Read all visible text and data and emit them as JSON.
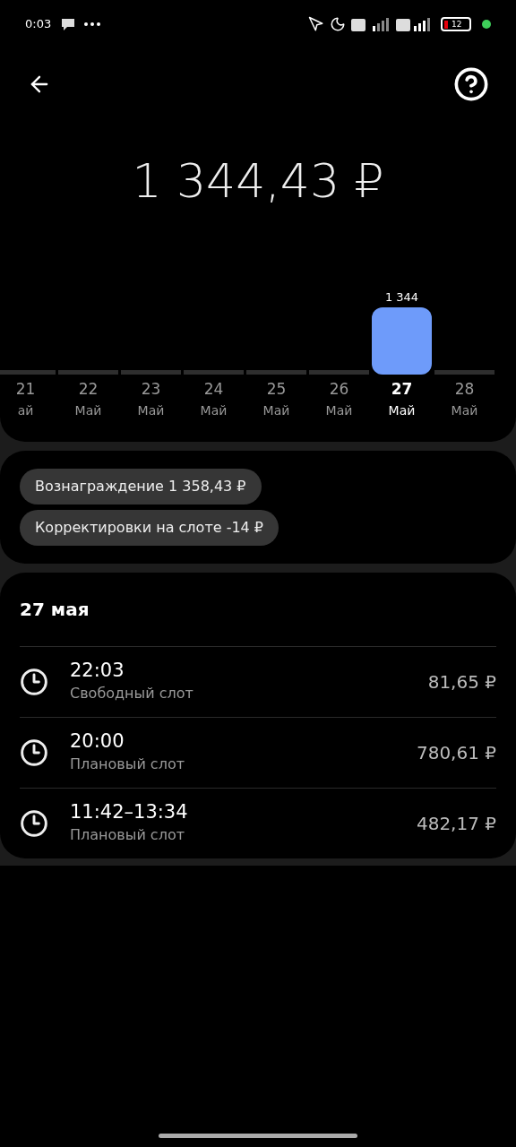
{
  "status_bar": {
    "time": "0:03",
    "battery": "12"
  },
  "total": "1 344,43 ₽",
  "chart_data": {
    "type": "bar",
    "categories": [
      "21",
      "22",
      "23",
      "24",
      "25",
      "26",
      "27",
      "28"
    ],
    "values": [
      0,
      0,
      0,
      0,
      0,
      0,
      1344,
      0
    ],
    "value_labels": [
      null,
      null,
      null,
      null,
      null,
      null,
      "1 344",
      null
    ]
  },
  "days": [
    {
      "month": "ай",
      "selected": false
    },
    {
      "month": "Май",
      "selected": false
    },
    {
      "month": "Май",
      "selected": false
    },
    {
      "month": "Май",
      "selected": false
    },
    {
      "month": "Май",
      "selected": false
    },
    {
      "month": "Май",
      "selected": false
    },
    {
      "month": "Май",
      "selected": true
    },
    {
      "month": "Май",
      "selected": false
    }
  ],
  "chips": [
    "Вознаграждение 1 358,43 ₽",
    "Корректировки на слоте -14 ₽"
  ],
  "day_title": "27 мая",
  "slots": [
    {
      "time": "22:03",
      "type": "Свободный слот",
      "amount": "81,65 ₽"
    },
    {
      "time": "20:00",
      "type": "Плановый слот",
      "amount": "780,61 ₽"
    },
    {
      "time": "11:42–13:34",
      "type": "Плановый слот",
      "amount": "482,17 ₽"
    }
  ]
}
